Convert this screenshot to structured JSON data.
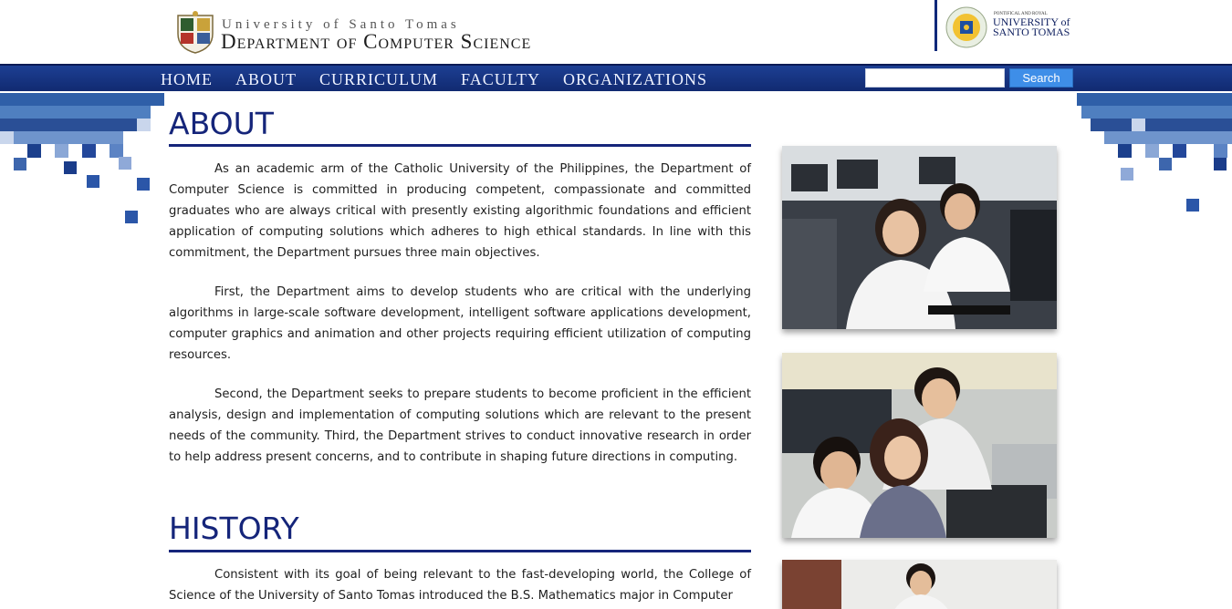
{
  "header": {
    "university_line": "University of Santo Tomas",
    "department_line": "Department of Computer Science",
    "seal_small_text": "PONTIFICAL AND ROYAL",
    "seal_name": "UNIVERSITY of SANTO TOMAS",
    "crest_icon": "university-crest-icon",
    "seal_icon": "ust-seal-icon"
  },
  "nav": {
    "items": [
      {
        "label": "HOME"
      },
      {
        "label": "ABOUT"
      },
      {
        "label": "CURRICULUM"
      },
      {
        "label": "FACULTY"
      },
      {
        "label": "ORGANIZATIONS"
      }
    ],
    "search_value": "",
    "search_button": "Search"
  },
  "colors": {
    "nav_bg": "#1d3f93",
    "heading": "#15257a",
    "search_button": "#3e8ee8"
  },
  "about": {
    "title": "ABOUT",
    "paragraphs": [
      "As an academic arm of the Catholic University of the Philippines, the Department of Computer Science is committed in producing competent, compassionate and committed graduates who are always critical with presently existing algorithmic foundations and efficient application of computing solutions which adheres to high ethical standards. In line with this commitment, the Department pursues three main objectives.",
      "First, the Department aims to develop students who are critical with the underlying algorithms in large-scale software development, intelligent software applications development, computer graphics and animation and other projects requiring efficient utilization of computing resources.",
      "Second, the Department seeks to prepare students to become proficient in the efficient analysis, design and implementation of computing solutions which are relevant to the present needs of the community. Third, the Department strives to conduct innovative research in order to help address present concerns, and to contribute in shaping future directions in computing."
    ]
  },
  "history": {
    "title": "HISTORY",
    "paragraphs": [
      "Consistent with its goal of being relevant to the fast-developing world, the College of Science of the University of Santo Tomas introduced the B.S. Mathematics major in Computer"
    ]
  },
  "photos": [
    {
      "icon": "students-computer-lab-photo"
    },
    {
      "icon": "students-at-workstation-photo"
    },
    {
      "icon": "student-portrait-photo"
    }
  ]
}
